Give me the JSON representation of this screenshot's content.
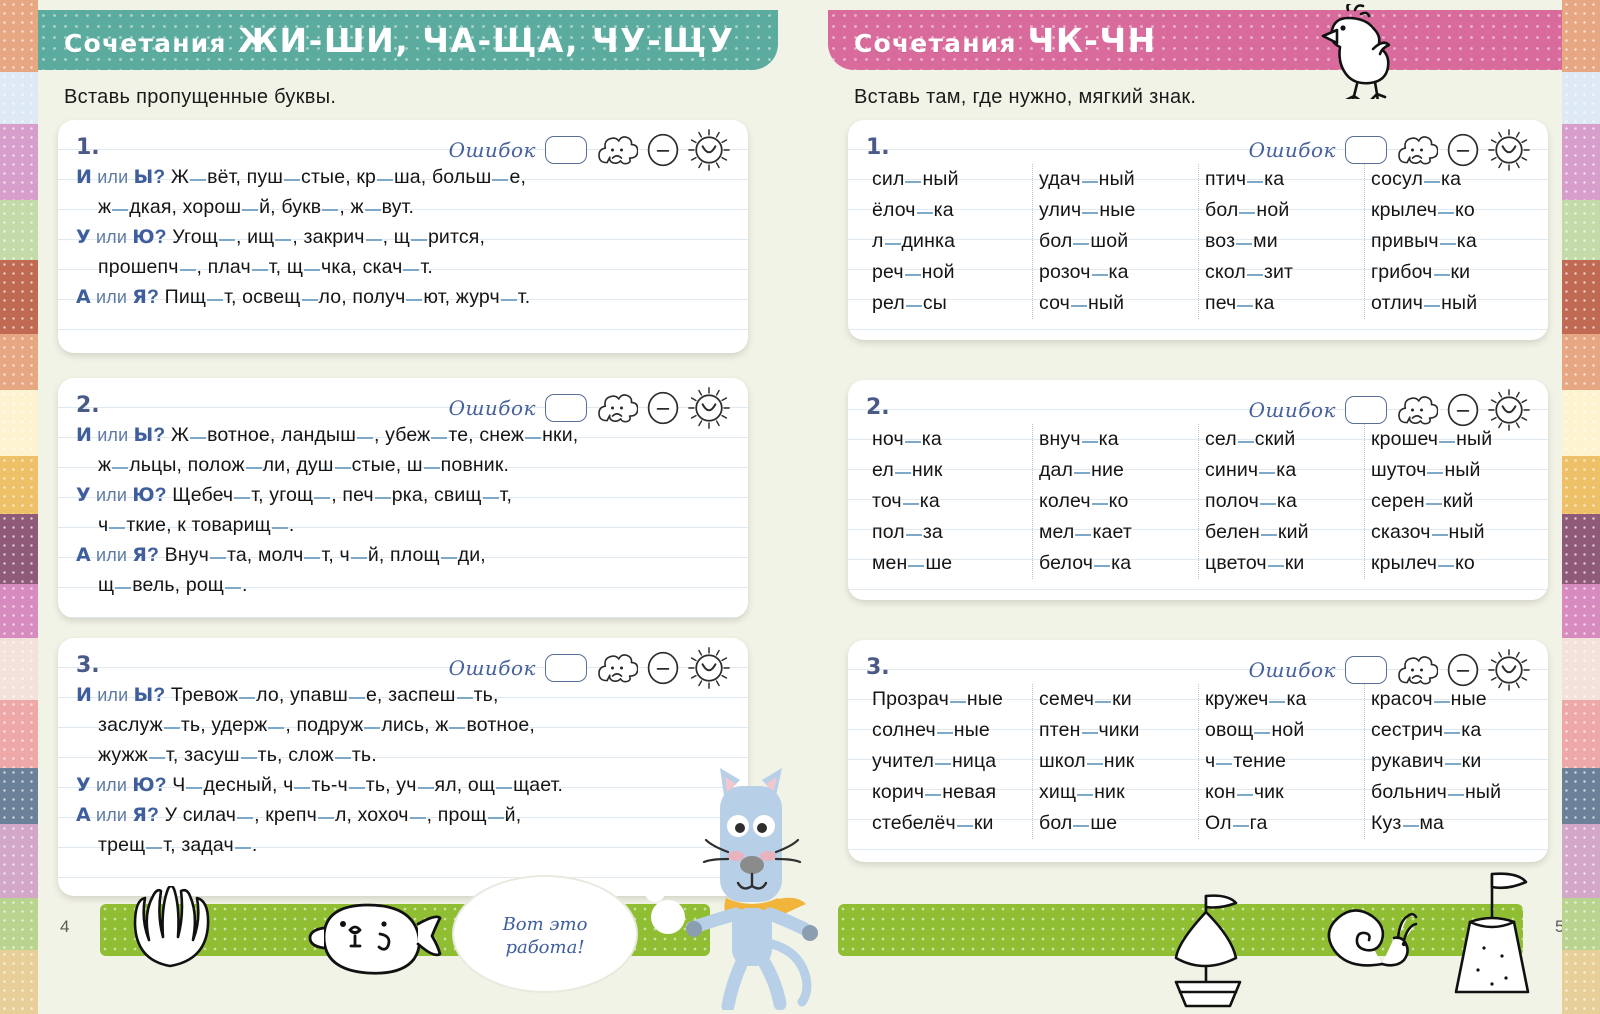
{
  "colors": {
    "banner_left": "#5cab9f",
    "banner_right": "#d86b9c",
    "accent_blue": "#3f5f9c",
    "gap_underline": "#7fa9c9",
    "green_bar": "#8fbe33",
    "page_bg": "#f2f3e7",
    "cat_body": "#b8cfe8",
    "scarf": "#f0b53a"
  },
  "border_colors": [
    "#e8a783",
    "#dde9f5",
    "#d79ecb",
    "#c3dba8",
    "#c06a54",
    "#e8a783",
    "#fdf3d0",
    "#eec068",
    "#8f5a78",
    "#d88bbf",
    "#f3e2dc",
    "#efa8a8",
    "#6a8199",
    "#d2a7c8",
    "#b9d48e",
    "#e8cf9a",
    "#c48fb0",
    "#e6e0c8",
    "#a9c4d8",
    "#dba89a"
  ],
  "left_page": {
    "banner": {
      "word": "Сочетания",
      "combos": "ЖИ-ШИ, ЧА-ЩА, ЧУ-ЩУ"
    },
    "instruction": "Вставь пропущенные буквы.",
    "page_number": "4",
    "exercises": [
      {
        "number": "1.",
        "errors_label": "Ошибок",
        "errors_value": "",
        "lines": [
          {
            "indent": false,
            "prompt": [
              "И",
              "или",
              "Ы",
              "?"
            ],
            "text": "Ж_вёт, пуш_стые, кр_ша, больш_е,"
          },
          {
            "indent": true,
            "prompt": null,
            "text": "ж_дкая, хорош_й, букв_, ж_вут."
          },
          {
            "indent": false,
            "prompt": [
              "У",
              "или",
              "Ю",
              "?"
            ],
            "text": "Угощ_, ищ_, закрич_, щ_рится,"
          },
          {
            "indent": true,
            "prompt": null,
            "text": "прошепч_, плач_т, щ_чка, скач_т."
          },
          {
            "indent": false,
            "prompt": [
              "А",
              "или",
              "Я",
              "?"
            ],
            "text": "Пищ_т, освещ_ло, получ_ют, журч_т."
          }
        ]
      },
      {
        "number": "2.",
        "errors_label": "Ошибок",
        "errors_value": "",
        "lines": [
          {
            "indent": false,
            "prompt": [
              "И",
              "или",
              "Ы",
              "?"
            ],
            "text": "Ж_вотное, ландыш_, убеж_те, снеж_нки,"
          },
          {
            "indent": true,
            "prompt": null,
            "text": "ж_льцы, полож_ли, душ_стые, ш_повник."
          },
          {
            "indent": false,
            "prompt": [
              "У",
              "или",
              "Ю",
              "?"
            ],
            "text": "Щебеч_т, угощ_, печ_рка, свищ_т,"
          },
          {
            "indent": true,
            "prompt": null,
            "text": "ч_ткие, к товарищ_."
          },
          {
            "indent": false,
            "prompt": [
              "А",
              "или",
              "Я",
              "?"
            ],
            "text": "Внуч_та, молч_т, ч_й, площ_ди,"
          },
          {
            "indent": true,
            "prompt": null,
            "text": "щ_вель, рощ_."
          }
        ]
      },
      {
        "number": "3.",
        "errors_label": "Ошибок",
        "errors_value": "",
        "lines": [
          {
            "indent": false,
            "prompt": [
              "И",
              "или",
              "Ы",
              "?"
            ],
            "text": "Тревож_ло, упавш_е, заспеш_ть,"
          },
          {
            "indent": true,
            "prompt": null,
            "text": "заслуж_ть, удерж_, подруж_лись, ж_вотное,"
          },
          {
            "indent": true,
            "prompt": null,
            "text": "жужж_т, засуш_ть, слож_ть."
          },
          {
            "indent": false,
            "prompt": [
              "У",
              "или",
              "Ю",
              "?"
            ],
            "text": "Ч_десный, ч_ть-ч_ть, уч_ял, ощ_щает."
          },
          {
            "indent": false,
            "prompt": [
              "А",
              "или",
              "Я",
              "?"
            ],
            "text": "У силач_, крепч_л, хохоч_, прощ_й,"
          },
          {
            "indent": true,
            "prompt": null,
            "text": "трещ_т, задач_."
          }
        ]
      }
    ],
    "speech_bubble": [
      "Вот это",
      "работа!"
    ]
  },
  "right_page": {
    "banner": {
      "word": "Сочетания",
      "combos": "ЧК-ЧН"
    },
    "instruction": "Вставь там, где нужно, мягкий знак.",
    "page_number": "5",
    "exercises": [
      {
        "number": "1.",
        "errors_label": "Ошибок",
        "errors_value": "",
        "columns": [
          [
            "сил_ный",
            "ёлоч_ка",
            "л_динка",
            "реч_ной",
            "рел_сы"
          ],
          [
            "удач_ный",
            "улич_ные",
            "бол_шой",
            "розоч_ка",
            "соч_ный"
          ],
          [
            "птич_ка",
            "бол_ной",
            "воз_ми",
            "скол_зит",
            "печ_ка"
          ],
          [
            "сосул_ка",
            "крылеч_ко",
            "привыч_ка",
            "грибоч_ки",
            "отлич_ный"
          ]
        ]
      },
      {
        "number": "2.",
        "errors_label": "Ошибок",
        "errors_value": "",
        "columns": [
          [
            "ноч_ка",
            "ел_ник",
            "точ_ка",
            "пол_за",
            "мен_ше"
          ],
          [
            "внуч_ка",
            "дал_ние",
            "колеч_ко",
            "мел_кает",
            "белоч_ка"
          ],
          [
            "сел_ский",
            "синич_ка",
            "полоч_ка",
            "белен_кий",
            "цветоч_ки"
          ],
          [
            "крошеч_ный",
            "шуточ_ный",
            "серен_кий",
            "сказоч_ный",
            "крылеч_ко"
          ]
        ]
      },
      {
        "number": "3.",
        "errors_label": "Ошибок",
        "errors_value": "",
        "columns": [
          [
            "Прозрач_ные",
            "солнеч_ные",
            "учител_ница",
            "корич_невая",
            "стебелёч_ки"
          ],
          [
            "семеч_ки",
            "птен_чики",
            "школ_ник",
            "хищ_ник",
            "бол_ше"
          ],
          [
            "кружеч_ка",
            "овощ_ной",
            "ч_тение",
            "кон_чик",
            "Ол_га"
          ],
          [
            "красоч_ные",
            "сестрич_ка",
            "рукавич_ки",
            "больнич_ный",
            "Куз_ма"
          ]
        ]
      }
    ]
  },
  "icons": {
    "cloud": "cloud-sad-icon",
    "neutral": "neutral-face-icon",
    "sun": "sun-happy-icon",
    "bird": "bird-doodle",
    "shell": "shell-doodle",
    "fish": "fish-doodle",
    "cat": "cat-character",
    "boat": "sailboat-doodle",
    "snail": "snail-doodle",
    "sandcastle": "sandcastle-doodle"
  }
}
